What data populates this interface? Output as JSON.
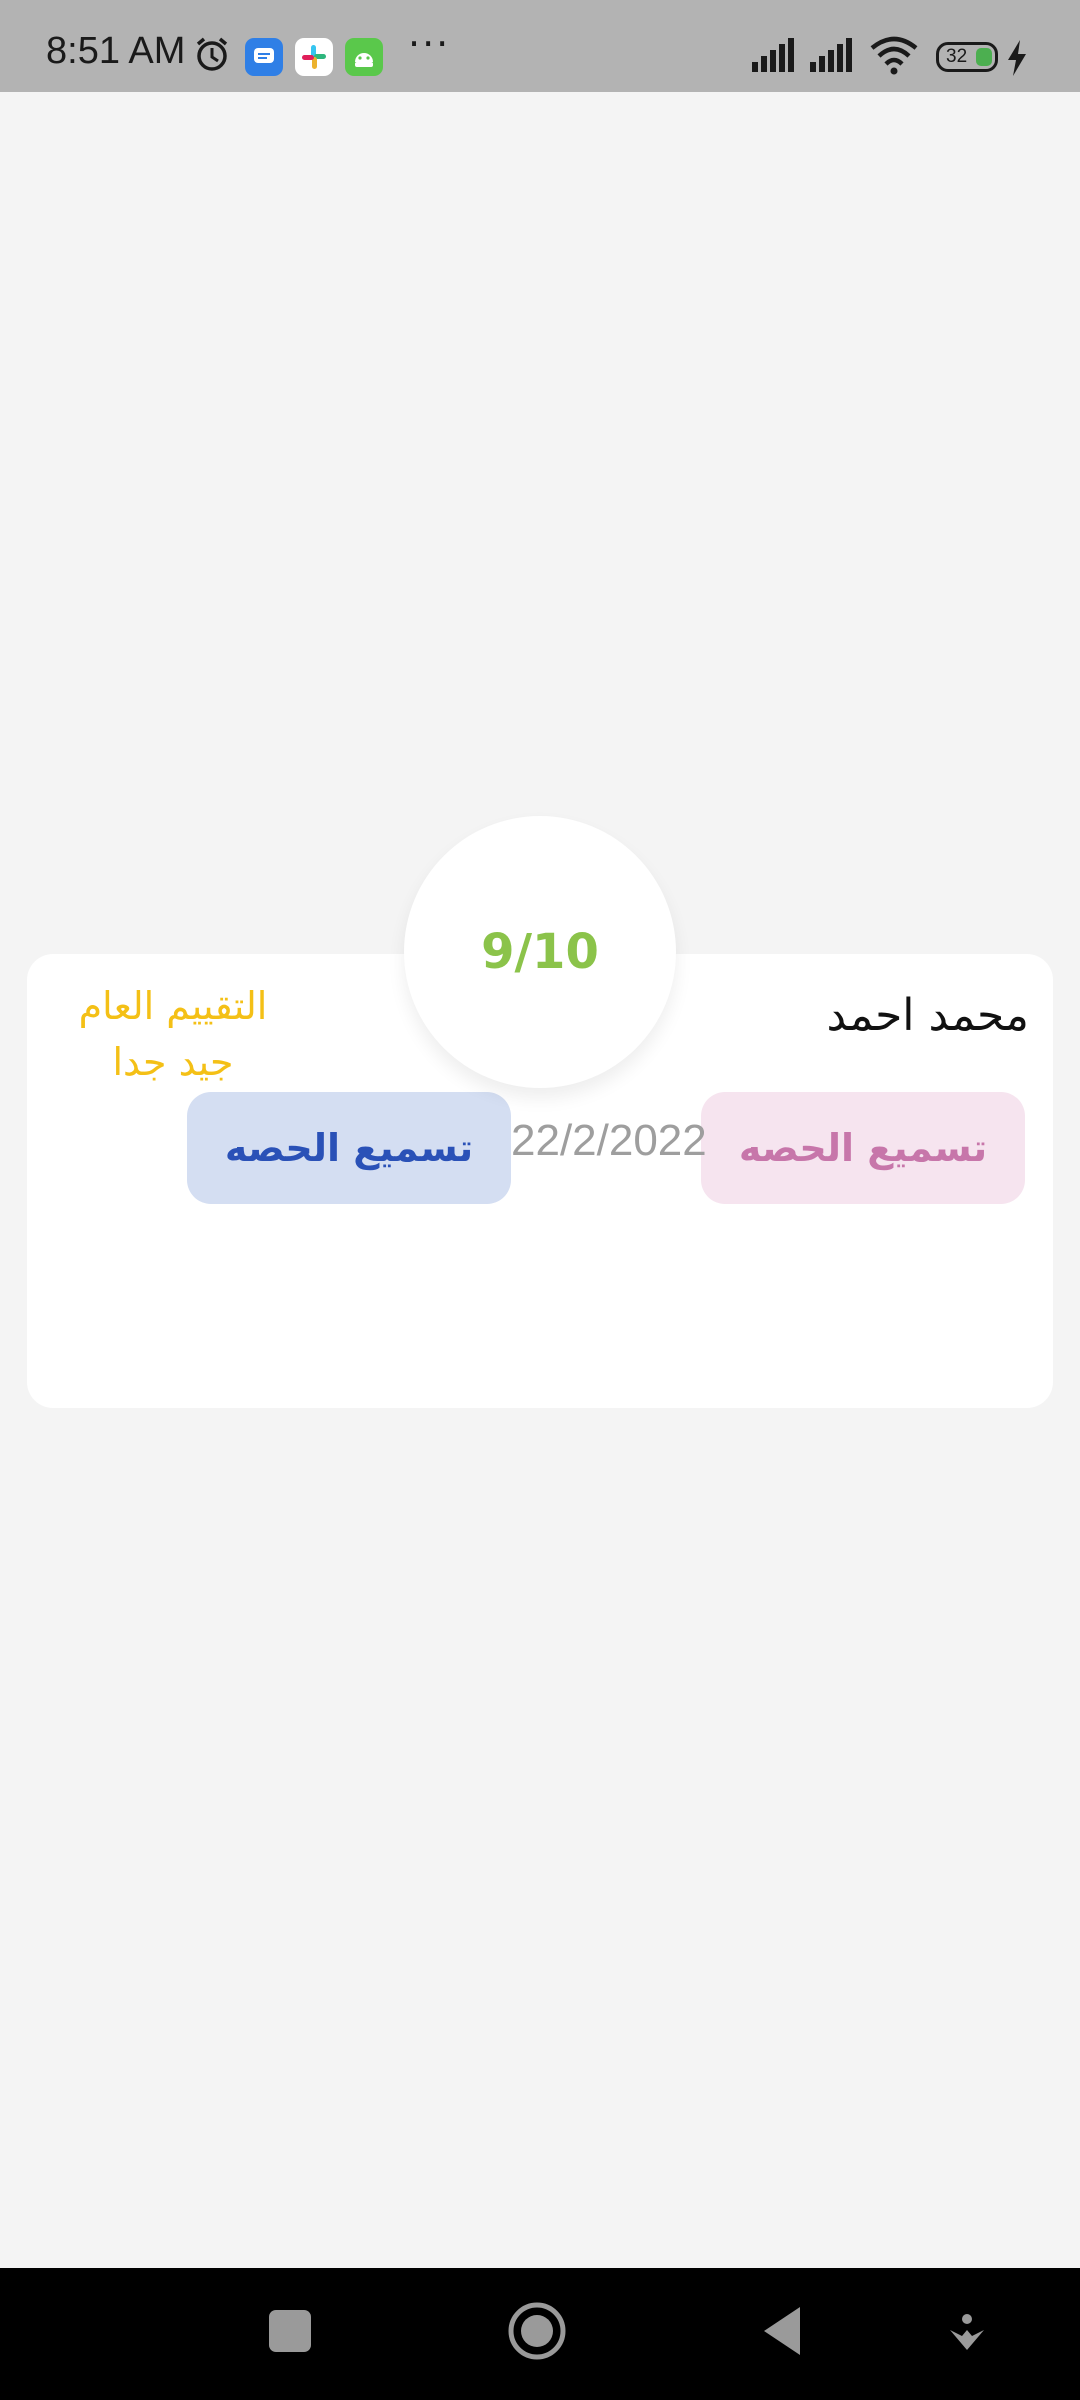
{
  "status_bar": {
    "time": "8:51 AM",
    "battery_level": "32",
    "icons": [
      "alarm-icon",
      "messages-app-icon",
      "slack-app-icon",
      "android-app-icon",
      "more-dots",
      "signal-icon",
      "signal-icon-2",
      "wifi-icon",
      "battery-icon",
      "charging-icon"
    ],
    "more": "···"
  },
  "card": {
    "score": "9/10",
    "student_name": "محمد احمد",
    "rating_label": "التقييم العام",
    "rating_value": "جيد جدا",
    "date": "22/2/2022",
    "button_pink_label": "تسميع الحصه",
    "button_blue_label": "تسميع الحصه"
  },
  "colors": {
    "background": "#f4f4f4",
    "score": "#8bc34a",
    "rating": "#f4c016",
    "pink_pill_bg": "#f6e4ef",
    "pink_pill_text": "#c776aa",
    "blue_pill_bg": "#d4def2",
    "blue_pill_text": "#2a51b7",
    "date": "#9e9e9e"
  },
  "nav_bar": {
    "buttons": [
      "recent-apps-icon",
      "home-icon",
      "back-icon",
      "assistant-icon"
    ]
  }
}
